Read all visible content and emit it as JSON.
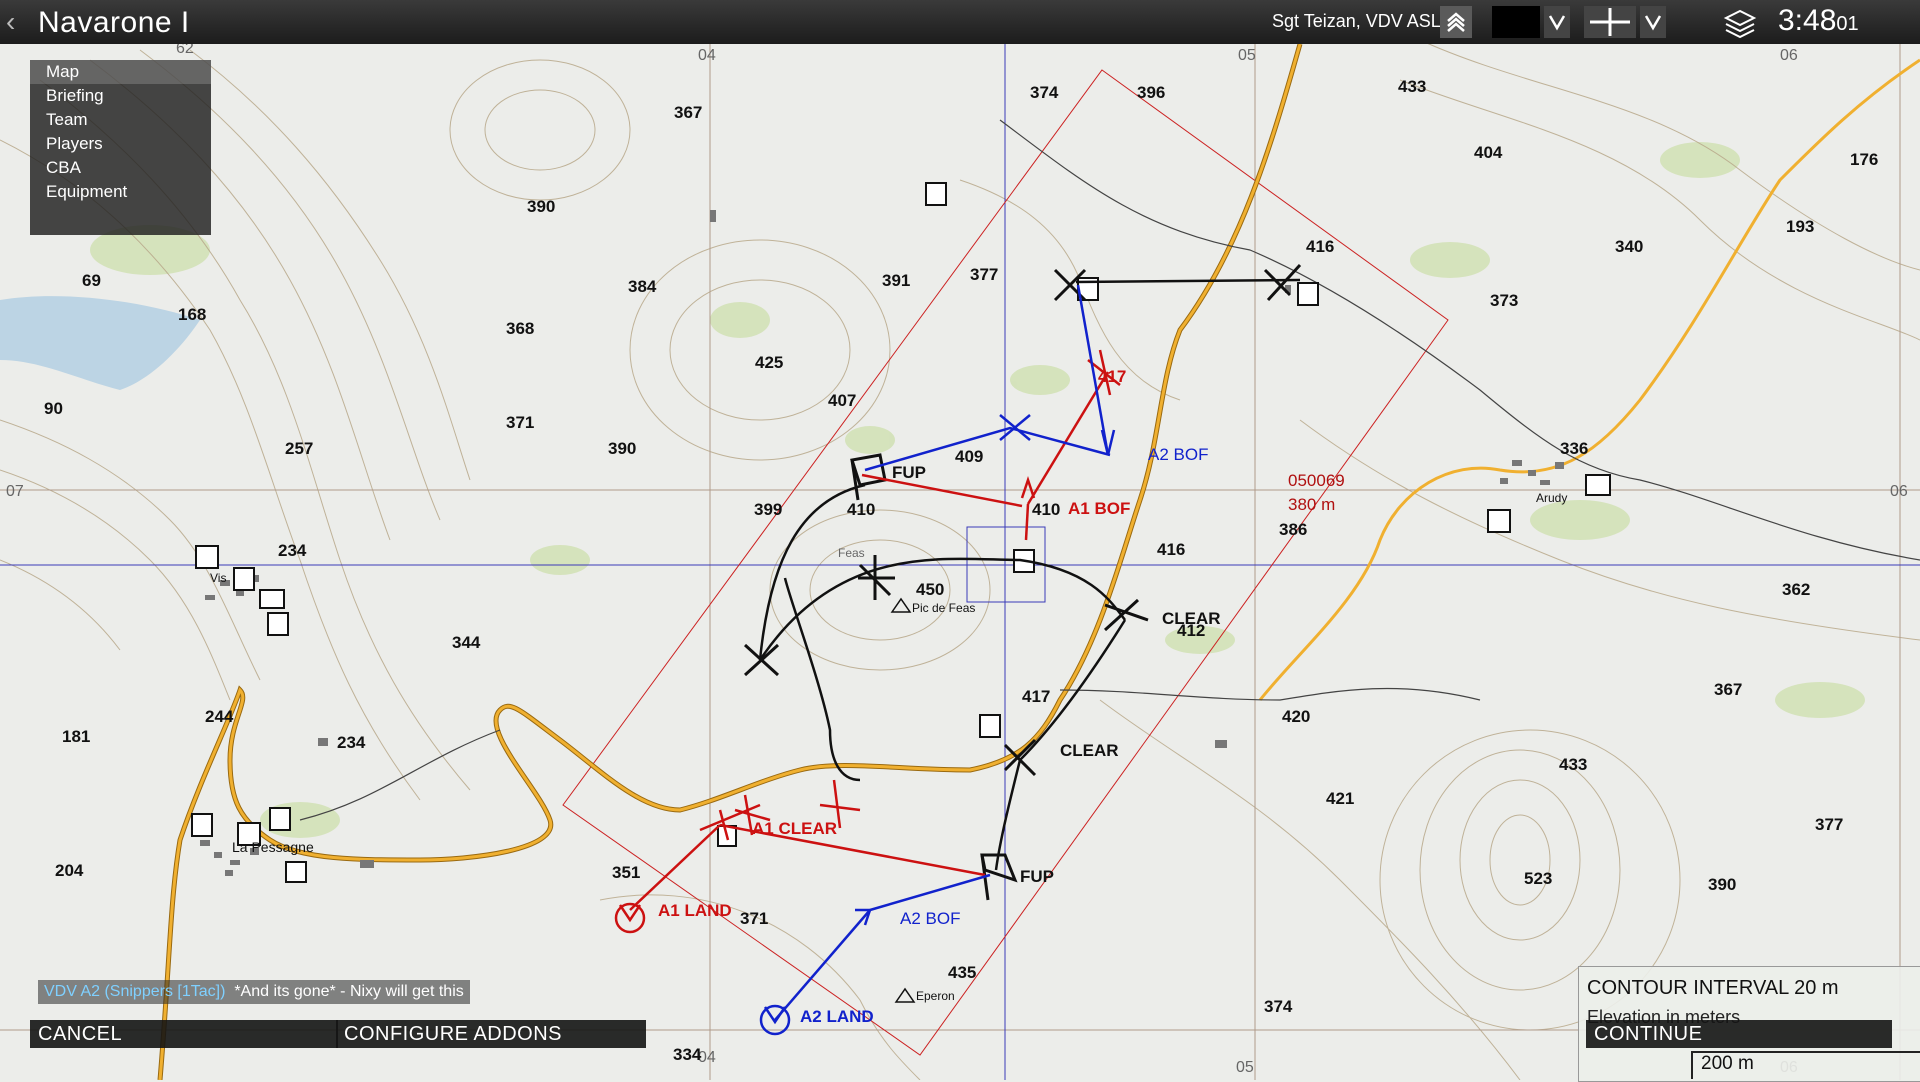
{
  "topbar": {
    "back_glyph": "‹",
    "title": "Navarone I",
    "player": "Sgt Teizan, VDV ASL 1",
    "time": "3:48",
    "seconds": "01",
    "icons": [
      "rank-chevron-icon",
      "color-chevron-down-icon",
      "marker-cross-icon",
      "marker-chevron-down-icon",
      "layers-icon"
    ]
  },
  "menu": {
    "items": [
      "Map",
      "Briefing",
      "Team",
      "Players",
      "CBA",
      "Equipment"
    ],
    "active": "Map"
  },
  "map": {
    "grid_labels": [
      "04",
      "05",
      "06",
      "07",
      "06",
      "62",
      "04",
      "05",
      "06"
    ],
    "elevations": [
      "367",
      "374",
      "396",
      "433",
      "404",
      "176",
      "390",
      "193",
      "340",
      "384",
      "391",
      "377",
      "416",
      "69",
      "168",
      "368",
      "373",
      "425",
      "90",
      "407",
      "257",
      "371",
      "390",
      "409",
      "336",
      "399",
      "410",
      "410",
      "386",
      "234",
      "416",
      "450",
      "362",
      "412",
      "344",
      "417",
      "420",
      "367",
      "244",
      "181",
      "234",
      "421",
      "433",
      "377",
      "204",
      "351",
      "371",
      "523",
      "390",
      "435",
      "374",
      "334"
    ],
    "places": [
      "Feas",
      "Pic de Feas",
      "Arudy",
      "La Pessagne",
      "Eperon",
      "Vis"
    ],
    "grid_ref": "050069",
    "distance": "380 m",
    "markers": {
      "black": [
        "FUP",
        "CLEAR",
        "CLEAR",
        "FUP"
      ],
      "red": [
        "A1 BOF",
        "A1 CLEAR",
        "A1 LAND",
        "417"
      ],
      "blue": [
        "A2 BOF",
        "A2 BOF",
        "A2 LAND"
      ]
    },
    "colors": {
      "black": "#111111",
      "red": "#cc1111",
      "blue": "#1122cc",
      "road": "#e6a020",
      "grid": "#3333bb"
    }
  },
  "chat": {
    "sender": "VDV A2 (Snippers [1Tac])",
    "message": "*And its gone* - Nixy will get this"
  },
  "buttons": {
    "cancel": "CANCEL",
    "configure_addons": "CONFIGURE ADDONS",
    "continue": "CONTINUE"
  },
  "legend": {
    "contour": "CONTOUR INTERVAL 20 m",
    "elevation": "Elevation in meters",
    "scale": "200 m"
  }
}
